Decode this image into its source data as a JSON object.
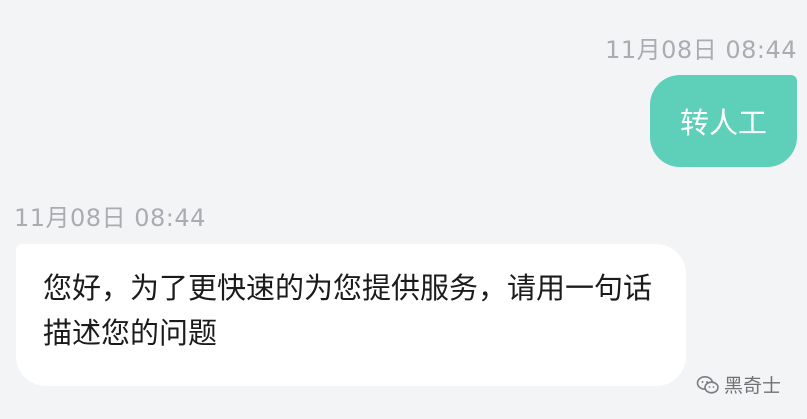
{
  "messages": [
    {
      "timestamp": "11月08日 08:44",
      "sender": "user",
      "text": "转人工"
    },
    {
      "timestamp": "11月08日 08:44",
      "sender": "agent",
      "text": "您好，为了更快速的为您提供服务，请用一句话描述您的问题"
    }
  ],
  "watermark": {
    "icon": "wechat-icon",
    "text": "黑奇士"
  },
  "colors": {
    "background": "#f3f4f6",
    "user_bubble": "#5ecfb8",
    "agent_bubble": "#ffffff",
    "timestamp": "#a9acb2"
  }
}
